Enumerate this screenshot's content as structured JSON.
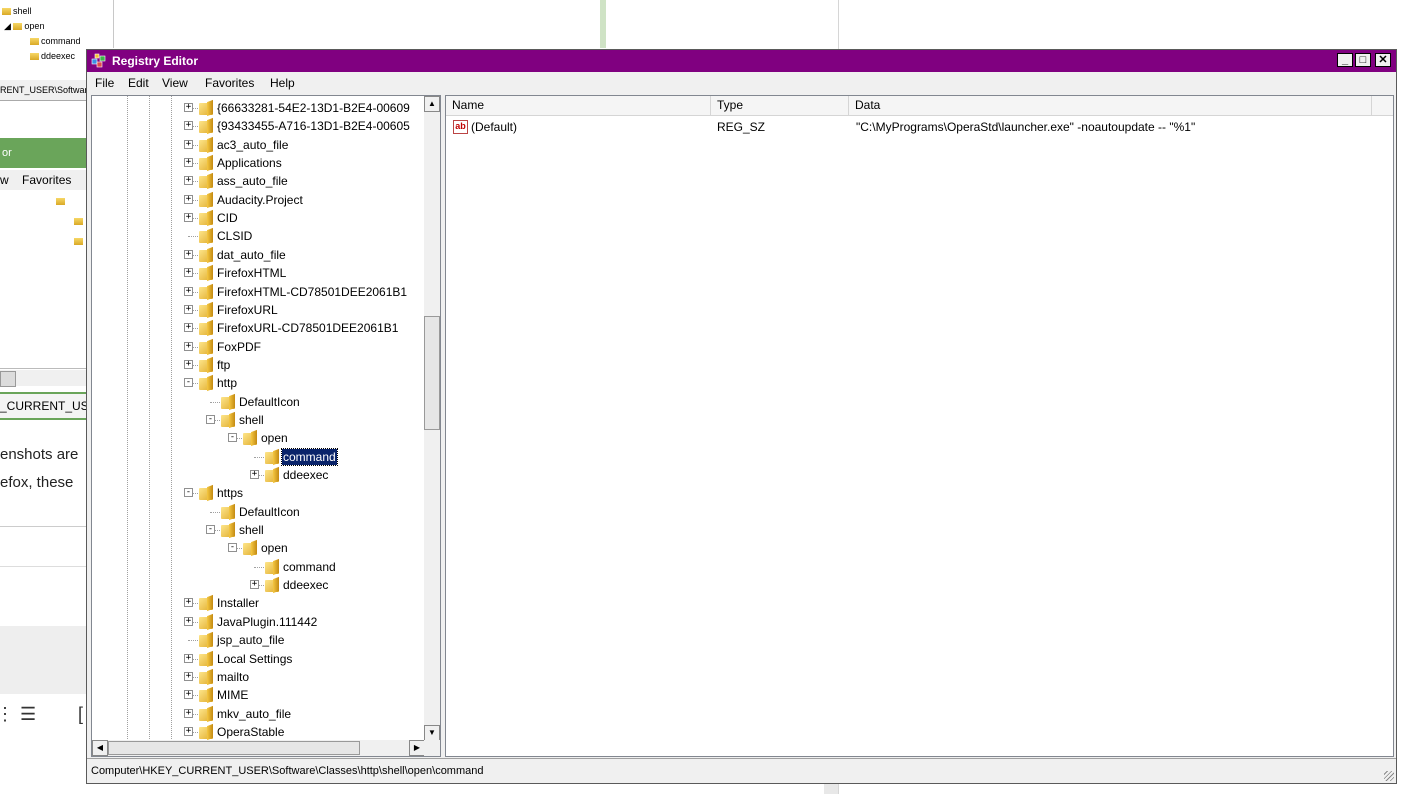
{
  "background": {
    "tree_items": [
      "shell",
      "open",
      "command",
      "ddeexec"
    ],
    "address_fragment": "RENT_USER\\Softwar",
    "window_title_fragment": "or",
    "menu_fragment": [
      "w",
      "Favorites"
    ],
    "path_fragment": "_CURRENT_USI",
    "text_lines": [
      "enshots are",
      "efox, these"
    ],
    "icons": [
      "list-bullets-icon",
      "list-numbered-icon"
    ]
  },
  "window": {
    "title": "Registry Editor",
    "icon": "registry-editor-icon",
    "controls": {
      "minimize": "_",
      "maximize": "□",
      "close": "✕"
    }
  },
  "menu": [
    "File",
    "Edit",
    "View",
    "Favorites",
    "Help"
  ],
  "tree": [
    {
      "label": "{66633281-54E2-13D1-B2E4-00609",
      "level": 0,
      "expander": "+"
    },
    {
      "label": "{93433455-A716-13D1-B2E4-00605",
      "level": 0,
      "expander": "+"
    },
    {
      "label": "ac3_auto_file",
      "level": 0,
      "expander": "+"
    },
    {
      "label": "Applications",
      "level": 0,
      "expander": "+"
    },
    {
      "label": "ass_auto_file",
      "level": 0,
      "expander": "+"
    },
    {
      "label": "Audacity.Project",
      "level": 0,
      "expander": "+"
    },
    {
      "label": "CID",
      "level": 0,
      "expander": "+"
    },
    {
      "label": "CLSID",
      "level": 0,
      "expander": ""
    },
    {
      "label": "dat_auto_file",
      "level": 0,
      "expander": "+"
    },
    {
      "label": "FirefoxHTML",
      "level": 0,
      "expander": "+"
    },
    {
      "label": "FirefoxHTML-CD78501DEE2061B1",
      "level": 0,
      "expander": "+"
    },
    {
      "label": "FirefoxURL",
      "level": 0,
      "expander": "+"
    },
    {
      "label": "FirefoxURL-CD78501DEE2061B1",
      "level": 0,
      "expander": "+"
    },
    {
      "label": "FoxPDF",
      "level": 0,
      "expander": "+"
    },
    {
      "label": "ftp",
      "level": 0,
      "expander": "+"
    },
    {
      "label": "http",
      "level": 0,
      "expander": "−"
    },
    {
      "label": "DefaultIcon",
      "level": 1,
      "expander": ""
    },
    {
      "label": "shell",
      "level": 1,
      "expander": "−"
    },
    {
      "label": "open",
      "level": 2,
      "expander": "−"
    },
    {
      "label": "command",
      "level": 3,
      "expander": "",
      "selected": true
    },
    {
      "label": "ddeexec",
      "level": 3,
      "expander": "+"
    },
    {
      "label": "https",
      "level": 0,
      "expander": "−"
    },
    {
      "label": "DefaultIcon",
      "level": 1,
      "expander": ""
    },
    {
      "label": "shell",
      "level": 1,
      "expander": "−"
    },
    {
      "label": "open",
      "level": 2,
      "expander": "−"
    },
    {
      "label": "command",
      "level": 3,
      "expander": ""
    },
    {
      "label": "ddeexec",
      "level": 3,
      "expander": "+"
    },
    {
      "label": "Installer",
      "level": 0,
      "expander": "+"
    },
    {
      "label": "JavaPlugin.111442",
      "level": 0,
      "expander": "+"
    },
    {
      "label": "jsp_auto_file",
      "level": 0,
      "expander": ""
    },
    {
      "label": "Local Settings",
      "level": 0,
      "expander": "+"
    },
    {
      "label": "mailto",
      "level": 0,
      "expander": "+"
    },
    {
      "label": "MIME",
      "level": 0,
      "expander": "+"
    },
    {
      "label": "mkv_auto_file",
      "level": 0,
      "expander": "+"
    },
    {
      "label": "OperaStable",
      "level": 0,
      "expander": "+"
    }
  ],
  "columns": [
    "Name",
    "Type",
    "Data"
  ],
  "values": [
    {
      "icon": "string-value-icon",
      "icon_text": "ab",
      "name": "(Default)",
      "type": "REG_SZ",
      "data": "\"C:\\MyPrograms\\OperaStd\\launcher.exe\" -noautoupdate -- \"%1\""
    }
  ],
  "status_path": "Computer\\HKEY_CURRENT_USER\\Software\\Classes\\http\\shell\\open\\command",
  "colors": {
    "titlebar": "#800080",
    "selection": "#0a246a",
    "background_green": "#6aa55a"
  }
}
